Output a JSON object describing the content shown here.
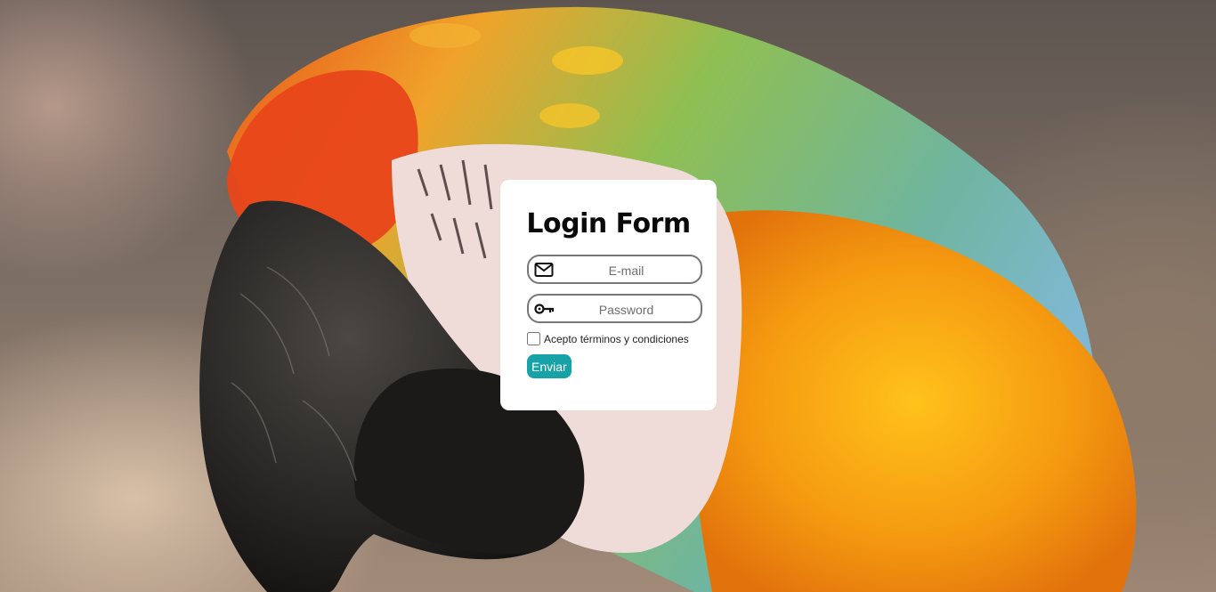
{
  "form": {
    "title": "Login Form",
    "email_placeholder": "E-mail",
    "password_placeholder": "Password",
    "terms_label": "Acepto términos y condiciones",
    "submit_label": "Enviar",
    "terms_checked": false
  },
  "icons": {
    "email": "envelope-icon",
    "password": "key-icon"
  },
  "colors": {
    "accent": "#17a2a8",
    "card": "#ffffff",
    "field_border": "#777777"
  }
}
